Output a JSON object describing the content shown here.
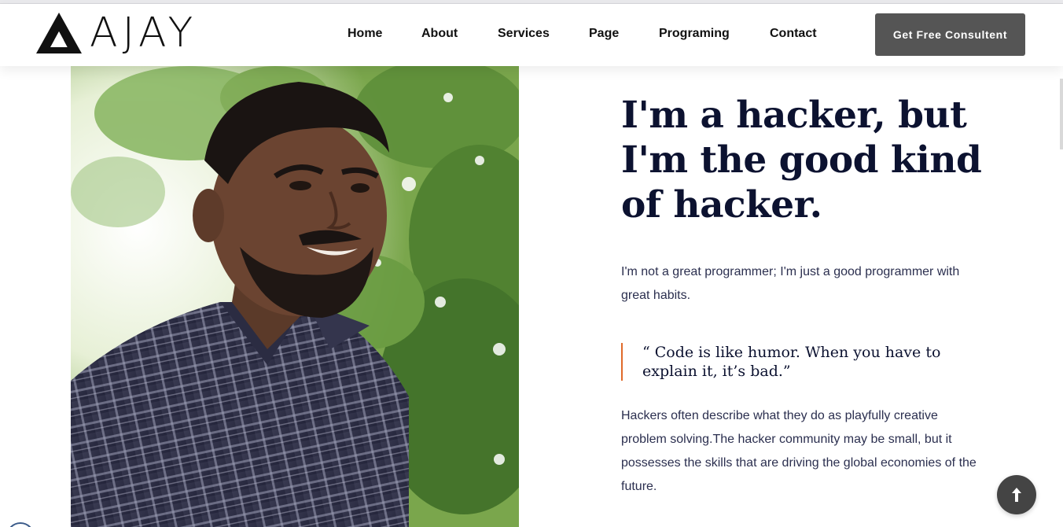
{
  "brand": {
    "logo_text": "AJAY",
    "logo_mark_icon": "triangle-a-logo-icon"
  },
  "nav": {
    "items": [
      {
        "label": "Home"
      },
      {
        "label": "About"
      },
      {
        "label": "Services"
      },
      {
        "label": "Page"
      },
      {
        "label": "Programing"
      },
      {
        "label": "Contact"
      }
    ],
    "cta_label": "Get Free Consultent"
  },
  "hero": {
    "photo_alt_icon": "portrait-photo",
    "headline": "I'm a hacker, but I'm the good kind of hacker.",
    "intro": "I'm not a great programmer; I'm just a good programmer with great habits.",
    "quote": "“ Code is like humor. When you have to explain it, it’s bad.”",
    "body": "Hackers often describe what they do as playfully creative problem solving.The hacker community may be small, but it possesses the skills that are driving the global economies of the future."
  },
  "controls": {
    "scroll_top_icon": "arrow-up-icon"
  },
  "colors": {
    "accent": "#e06a2a",
    "cta_bg": "#555555",
    "heading": "#0c1230"
  }
}
